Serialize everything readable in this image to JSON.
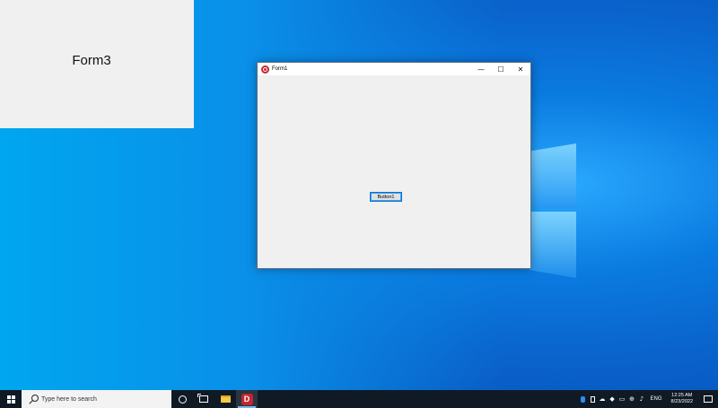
{
  "desktop": {
    "form3": {
      "label": "Form3"
    },
    "form1": {
      "title": "Form1",
      "caption": {
        "minimize": "—",
        "maximize": "☐",
        "close": "✕"
      },
      "button": "Button1"
    }
  },
  "taskbar": {
    "search_placeholder": "Type here to search",
    "apps": [
      {
        "name": "cortana",
        "icon": "circle-icon"
      },
      {
        "name": "task-view",
        "icon": "task-view-icon"
      },
      {
        "name": "file-explorer",
        "icon": "folder-icon"
      },
      {
        "name": "delphi-app",
        "icon": "d-app-icon",
        "label": "D"
      }
    ],
    "tray": {
      "language": "ENG",
      "time": "12:25 AM",
      "date": "8/23/2022"
    }
  }
}
